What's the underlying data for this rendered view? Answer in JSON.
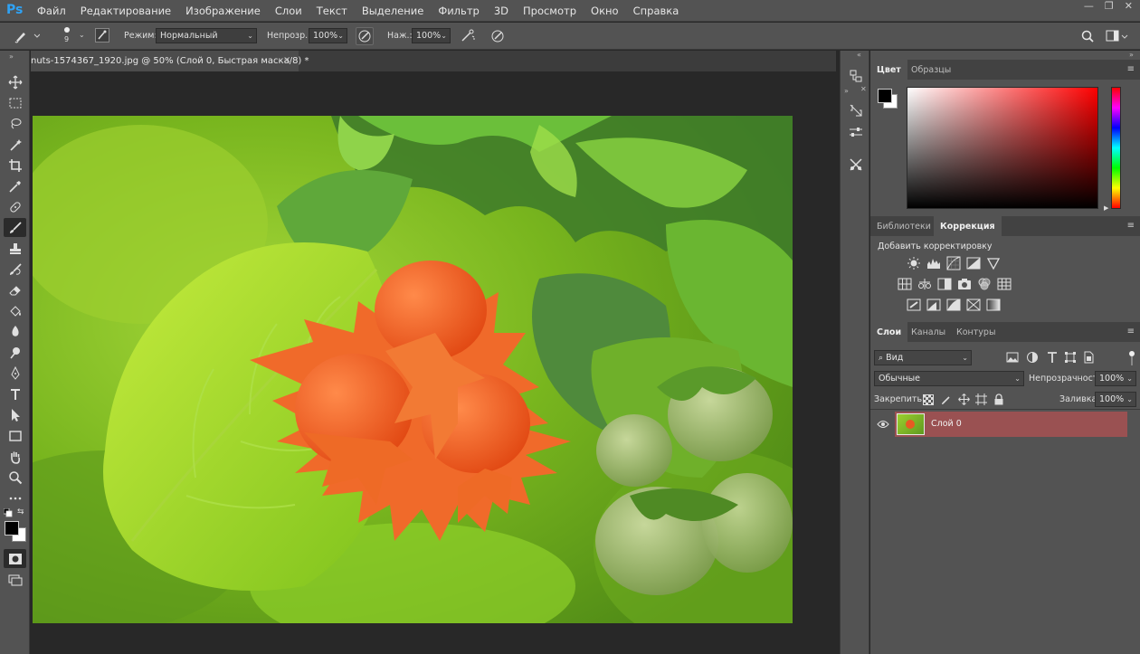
{
  "app": {
    "logo": "Ps",
    "menu": [
      "Файл",
      "Редактирование",
      "Изображение",
      "Слои",
      "Текст",
      "Выделение",
      "Фильтр",
      "3D",
      "Просмотр",
      "Окно",
      "Справка"
    ],
    "window_controls": [
      "—",
      "❐",
      "✕"
    ]
  },
  "options": {
    "brush_size": "9",
    "mode_label": "Режим:",
    "mode_value": "Нормальный",
    "opacity_label": "Непрозр.:",
    "opacity_value": "100%",
    "flow_label": "Наж.:",
    "flow_value": "100%"
  },
  "document": {
    "tab_title": "nuts-1574367_1920.jpg @ 50% (Слой 0, Быстрая маска/8) *",
    "close": "×"
  },
  "color_panel": {
    "tabs": [
      "Цвет",
      "Образцы"
    ],
    "active_tab": "Цвет",
    "foreground": "#000000",
    "background": "#ffffff",
    "hue": "#ff0000"
  },
  "adjust_panel": {
    "tabs": [
      "Библиотеки",
      "Коррекция"
    ],
    "active_tab": "Коррекция",
    "heading": "Добавить корректировку"
  },
  "layers_panel": {
    "tabs": [
      "Слои",
      "Каналы",
      "Контуры"
    ],
    "active_tab": "Слои",
    "filter_label": "Вид",
    "blend_mode": "Обычные",
    "opacity_label": "Непрозрачность:",
    "opacity_value": "100%",
    "lock_label": "Закрепить:",
    "fill_label": "Заливка:",
    "fill_value": "100%",
    "layers": [
      {
        "name": "Слой 0",
        "visible": true,
        "selected": true
      }
    ]
  },
  "colors": {
    "ps_blue": "#2fa3f6",
    "layer_selected": "#9a5152",
    "panel_bg": "#535353",
    "canvas_bg": "#282828"
  }
}
